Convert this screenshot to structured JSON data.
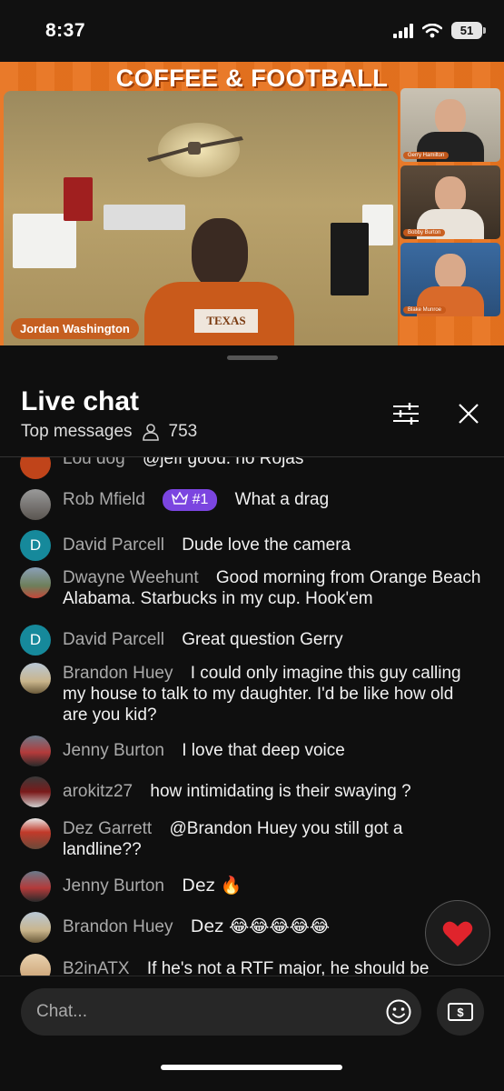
{
  "status": {
    "time": "8:37",
    "battery": "51"
  },
  "video": {
    "title": "COFFEE & FOOTBALL",
    "host_name": "Jordan Washington",
    "shirt_text": "TEXAS",
    "guests": [
      {
        "name": "Gerry Hamilton"
      },
      {
        "name": "Bobby Burton"
      },
      {
        "name": "Blake Munroe"
      }
    ]
  },
  "chat": {
    "title": "Live chat",
    "mode": "Top messages",
    "viewers": "753",
    "input_placeholder": "Chat...",
    "messages": [
      {
        "author": "Lou dog",
        "text": "@jeff good. no Rojas"
      },
      {
        "author": "Rob Mfield",
        "badge": "#1",
        "text": "What a drag"
      },
      {
        "author": "David Parcell",
        "avatar_letter": "D",
        "text": "Dude love the camera"
      },
      {
        "author": "Dwayne Weehunt",
        "text": "Good morning from Orange Beach Alabama. Starbucks in my cup. Hook'em"
      },
      {
        "author": "David Parcell",
        "avatar_letter": "D",
        "text": "Great question Gerry"
      },
      {
        "author": "Brandon Huey",
        "text": "I could only imagine this guy calling my house to talk to my daughter. I'd be like how old are you kid?"
      },
      {
        "author": "Jenny Burton",
        "text": "I love that deep voice"
      },
      {
        "author": "arokitz27",
        "text": "how intimidating is their swaying ?"
      },
      {
        "author": "Dez Garrett",
        "text": "@Brandon Huey you still got a landline??"
      },
      {
        "author": "Jenny Burton",
        "text": "Dez 🔥"
      },
      {
        "author": "Brandon Huey",
        "text": "Dez 😂😂😂😂😂"
      },
      {
        "author": "B2inATX",
        "text": "If he's not a RTF major, he should be"
      }
    ]
  },
  "colors": {
    "accent_orange": "#e8731f",
    "badge_purple": "#7b45e0",
    "heart_red": "#e0242c"
  }
}
